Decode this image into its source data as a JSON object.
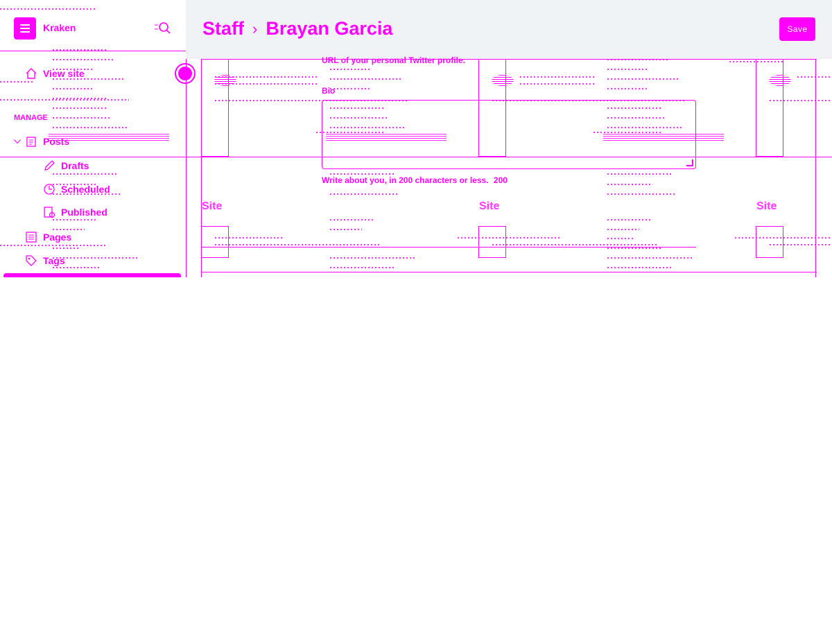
{
  "app": {
    "name": "Kraken"
  },
  "sidebar": {
    "view_site": "View site",
    "section_label": "MANAGE",
    "posts": "Posts",
    "drafts": "Drafts",
    "scheduled": "Scheduled",
    "published": "Published",
    "pages": "Pages",
    "tags": "Tags"
  },
  "header": {
    "breadcrumb_parent": "Staff",
    "breadcrumb_current": "Brayan Garcia",
    "save_label": "Save"
  },
  "form": {
    "twitter_help": "URL of your personal Twitter profile.",
    "bio_label": "Bio",
    "bio_value": "",
    "bio_help": "Write about you, in 200 characters or less.",
    "bio_count": "200"
  },
  "background_cards": {
    "title": "Site"
  },
  "colors": {
    "accent": "#ff00ff",
    "topbar": "#f1f2f6",
    "background": "#ffffff"
  },
  "icons": [
    "menu-icon",
    "search-icon",
    "house-icon",
    "chevron-down-icon",
    "posts-icon",
    "pencil-icon",
    "clock-icon",
    "published-icon",
    "pages-icon",
    "tag-icon"
  ]
}
